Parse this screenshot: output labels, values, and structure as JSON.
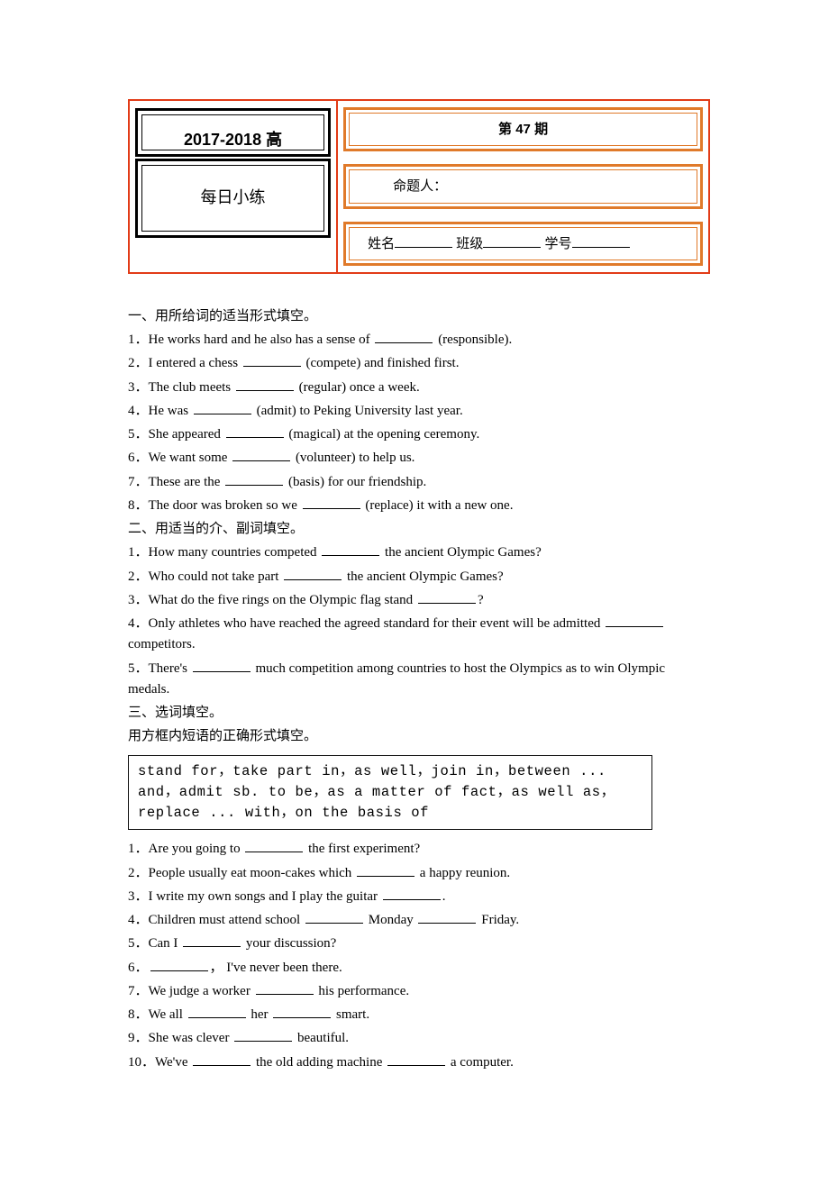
{
  "header": {
    "year_range": "2017-2018 高",
    "subtitle": "每日小练",
    "issue_prefix": "第",
    "issue_number": "47",
    "issue_suffix": "期",
    "author_label": "命题人：",
    "name_label": "姓名",
    "class_label": "班级",
    "sid_label": "学号"
  },
  "sections": {
    "s1": {
      "title": "一、用所给词的适当形式填空。",
      "items": [
        {
          "pre": "1．He works hard and he also has a sense of ",
          "post": " (responsible)."
        },
        {
          "pre": "2．I entered a chess ",
          "post": " (compete) and finished first."
        },
        {
          "pre": "3．The club meets ",
          "post": " (regular) once a week."
        },
        {
          "pre": "4．He was ",
          "post": " (admit) to Peking University last year."
        },
        {
          "pre": "5．She appeared ",
          "post": " (magical) at the opening ceremony."
        },
        {
          "pre": "6．We want some ",
          "post": " (volunteer) to help us."
        },
        {
          "pre": "7．These are the ",
          "post": " (basis) for our friendship."
        },
        {
          "pre": "8．The door was broken so we ",
          "post": " (replace) it with a new one."
        }
      ]
    },
    "s2": {
      "title": "二、用适当的介、副词填空。",
      "items": [
        {
          "pre": "1．How many countries competed ",
          "post": " the ancient Olympic Games?"
        },
        {
          "pre": "2．Who could not take part ",
          "post": " the ancient Olympic Games?"
        },
        {
          "pre": "3．What do the five rings on the Olympic flag stand ",
          "post": "?"
        },
        {
          "pre": "4．Only athletes who have reached the agreed standard for their event will be admitted ",
          "post": " competitors."
        },
        {
          "pre": "5．There's ",
          "post": " much competition among countries to host the Olympics as to win Olympic medals."
        }
      ]
    },
    "s3": {
      "title": "三、选词填空。",
      "instruction": "用方框内短语的正确形式填空。",
      "phrase_box": "stand for，take part in，as well，join in，between ... and，admit sb. to be，as a matter of fact，as well as，replace ... with，on the basis of",
      "items": [
        {
          "parts": [
            "1．Are you going to ",
            " the first experiment?"
          ]
        },
        {
          "parts": [
            "2．People usually eat moon-cakes which ",
            " a happy reunion."
          ]
        },
        {
          "parts": [
            "3．I write my own songs and I play the guitar ",
            "."
          ]
        },
        {
          "parts": [
            "4．Children must attend school ",
            " Monday ",
            " Friday."
          ]
        },
        {
          "parts": [
            "5．Can I ",
            " your discussion?"
          ]
        },
        {
          "parts": [
            "6．",
            "， I've never been there."
          ]
        },
        {
          "parts": [
            "7．We judge a worker ",
            " his performance."
          ]
        },
        {
          "parts": [
            "8．We all ",
            " her ",
            " smart."
          ]
        },
        {
          "parts": [
            "9．She was clever ",
            " beautiful."
          ]
        },
        {
          "parts": [
            "10．We've ",
            " the old adding machine ",
            " a computer."
          ]
        }
      ]
    }
  }
}
